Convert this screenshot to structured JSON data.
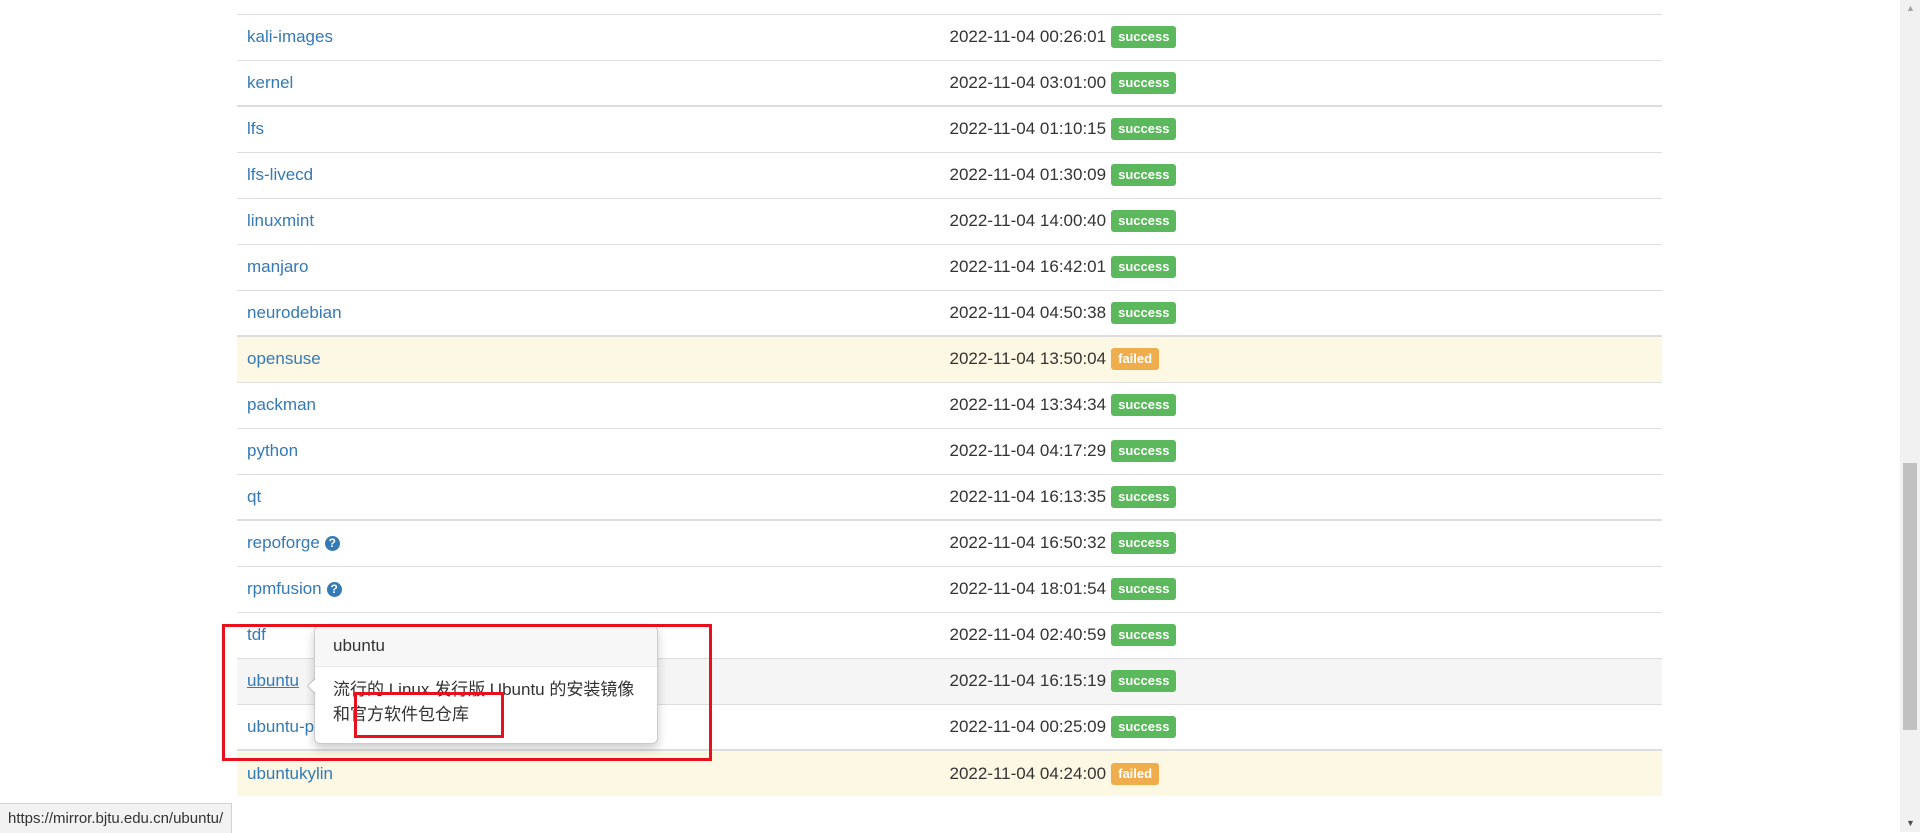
{
  "mirrors": [
    {
      "name": "kali-images",
      "updated": "2022-11-04 00:26:01",
      "status": "success",
      "has_help": false
    },
    {
      "name": "kernel",
      "updated": "2022-11-04 03:01:00",
      "status": "success",
      "has_help": false
    },
    {
      "name": "lfs",
      "updated": "2022-11-04 01:10:15",
      "status": "success",
      "has_help": false
    },
    {
      "name": "lfs-livecd",
      "updated": "2022-11-04 01:30:09",
      "status": "success",
      "has_help": false
    },
    {
      "name": "linuxmint",
      "updated": "2022-11-04 14:00:40",
      "status": "success",
      "has_help": false
    },
    {
      "name": "manjaro",
      "updated": "2022-11-04 16:42:01",
      "status": "success",
      "has_help": false
    },
    {
      "name": "neurodebian",
      "updated": "2022-11-04 04:50:38",
      "status": "success",
      "has_help": false
    },
    {
      "name": "opensuse",
      "updated": "2022-11-04 13:50:04",
      "status": "failed",
      "has_help": false
    },
    {
      "name": "packman",
      "updated": "2022-11-04 13:34:34",
      "status": "success",
      "has_help": false
    },
    {
      "name": "python",
      "updated": "2022-11-04 04:17:29",
      "status": "success",
      "has_help": false
    },
    {
      "name": "qt",
      "updated": "2022-11-04 16:13:35",
      "status": "success",
      "has_help": false
    },
    {
      "name": "repoforge",
      "updated": "2022-11-04 16:50:32",
      "status": "success",
      "has_help": true
    },
    {
      "name": "rpmfusion",
      "updated": "2022-11-04 18:01:54",
      "status": "success",
      "has_help": true
    },
    {
      "name": "tdf",
      "updated": "2022-11-04 02:40:59",
      "status": "success",
      "has_help": false
    },
    {
      "name": "ubuntu",
      "updated": "2022-11-04 16:15:19",
      "status": "success",
      "has_help": false
    },
    {
      "name": "ubuntu-ports",
      "updated": "2022-11-04 00:25:09",
      "status": "success",
      "has_help": false
    },
    {
      "name": "ubuntukylin",
      "updated": "2022-11-04 04:24:00",
      "status": "failed",
      "has_help": false
    }
  ],
  "popover": {
    "title": "ubuntu",
    "content": "流行的 Linux 发行版 Ubuntu 的安装镜像和官方软件包仓库"
  },
  "status_bar": {
    "url": "https://mirror.bjtu.edu.cn/ubuntu/"
  },
  "help_icon_glyph": "?",
  "colors": {
    "link": "#337ab7",
    "success": "#5cb85c",
    "failed": "#f0ad4e",
    "failed_row": "#fcf8e3",
    "highlight": "#e8101d"
  }
}
